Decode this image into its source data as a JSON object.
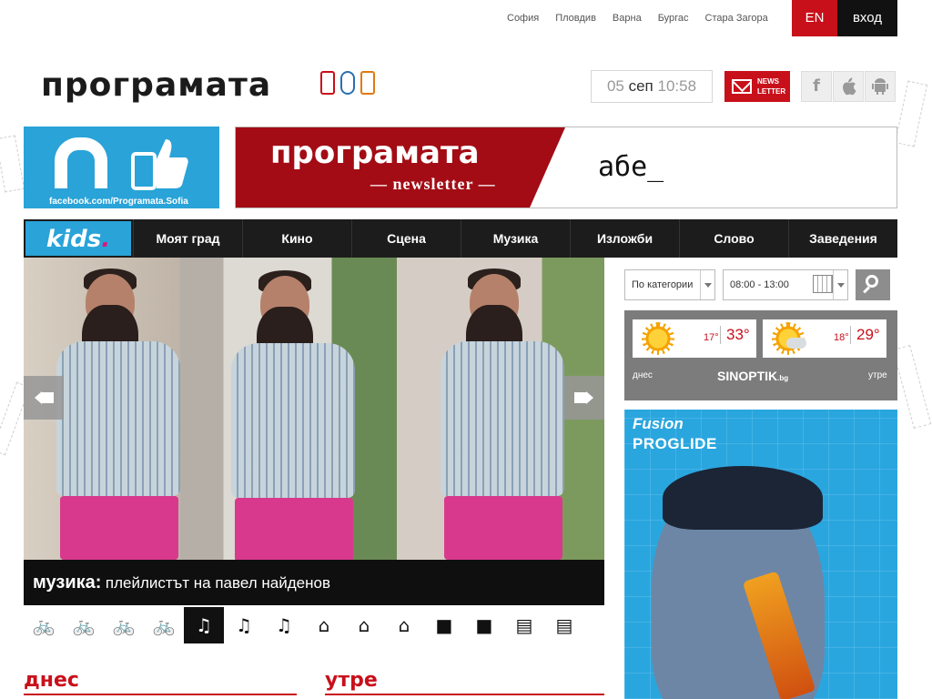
{
  "topnav": {
    "cities": [
      "София",
      "Пловдив",
      "Варна",
      "Бургас",
      "Стара Загора"
    ],
    "lang": "EN",
    "login": "вход"
  },
  "header": {
    "logo": "програмата",
    "date_day": "05",
    "date_month": "сеп",
    "date_time": "10:58",
    "newsletter_line1": "NEWS",
    "newsletter_line2": "LETTER",
    "social": [
      {
        "name": "facebook-icon",
        "glyph": "f"
      },
      {
        "name": "apple-icon",
        "glyph": ""
      },
      {
        "name": "android-icon",
        "glyph": "☂"
      }
    ]
  },
  "banners": {
    "facebook_url": "facebook.com/Programata.Sofia",
    "newsletter_brand": "програмата",
    "newsletter_sub": "— newsletter —",
    "newsletter_typed": "абе_"
  },
  "mainnav": {
    "kids": "kids",
    "kids_dot": ".",
    "items": [
      "Моят град",
      "Кино",
      "Сцена",
      "Музика",
      "Изложби",
      "Слово",
      "Заведения"
    ]
  },
  "slider": {
    "category": "музика:",
    "title": "плейлистът на павел найденов",
    "thumbs": [
      {
        "name": "bike-icon",
        "glyph": "🚲",
        "active": false
      },
      {
        "name": "bike-icon",
        "glyph": "🚲",
        "active": false
      },
      {
        "name": "bike-icon",
        "glyph": "🚲",
        "active": false
      },
      {
        "name": "bike-icon",
        "glyph": "🚲",
        "active": false
      },
      {
        "name": "music-note-icon",
        "glyph": "♫",
        "active": true
      },
      {
        "name": "music-note-icon",
        "glyph": "♫",
        "active": false
      },
      {
        "name": "music-note-icon",
        "glyph": "♫",
        "active": false
      },
      {
        "name": "museum-icon",
        "glyph": "⌂",
        "active": false
      },
      {
        "name": "museum-icon",
        "glyph": "⌂",
        "active": false
      },
      {
        "name": "museum-icon",
        "glyph": "⌂",
        "active": false
      },
      {
        "name": "film-camera-icon",
        "glyph": "■",
        "active": false
      },
      {
        "name": "film-camera-icon",
        "glyph": "■",
        "active": false
      },
      {
        "name": "book-icon",
        "glyph": "▤",
        "active": false
      },
      {
        "name": "book-icon",
        "glyph": "▤",
        "active": false
      }
    ]
  },
  "sections": {
    "today": "днес",
    "tomorrow": "утре"
  },
  "filters": {
    "category": "По категории",
    "time": "08:00 - 13:00"
  },
  "weather": {
    "today_min": "17°",
    "today_max": "33°",
    "tomorrow_min": "18°",
    "tomorrow_max": "29°",
    "today_label": "днес",
    "tomorrow_label": "утре",
    "provider": "SINOPTIK",
    "provider_tld": ".bg"
  },
  "ad": {
    "line1": "Fusion",
    "line2": "PROGLIDE"
  },
  "colors": {
    "accent_red": "#c8101b",
    "kids_blue": "#29a3d8",
    "nav_dark": "#1c1c1c"
  }
}
